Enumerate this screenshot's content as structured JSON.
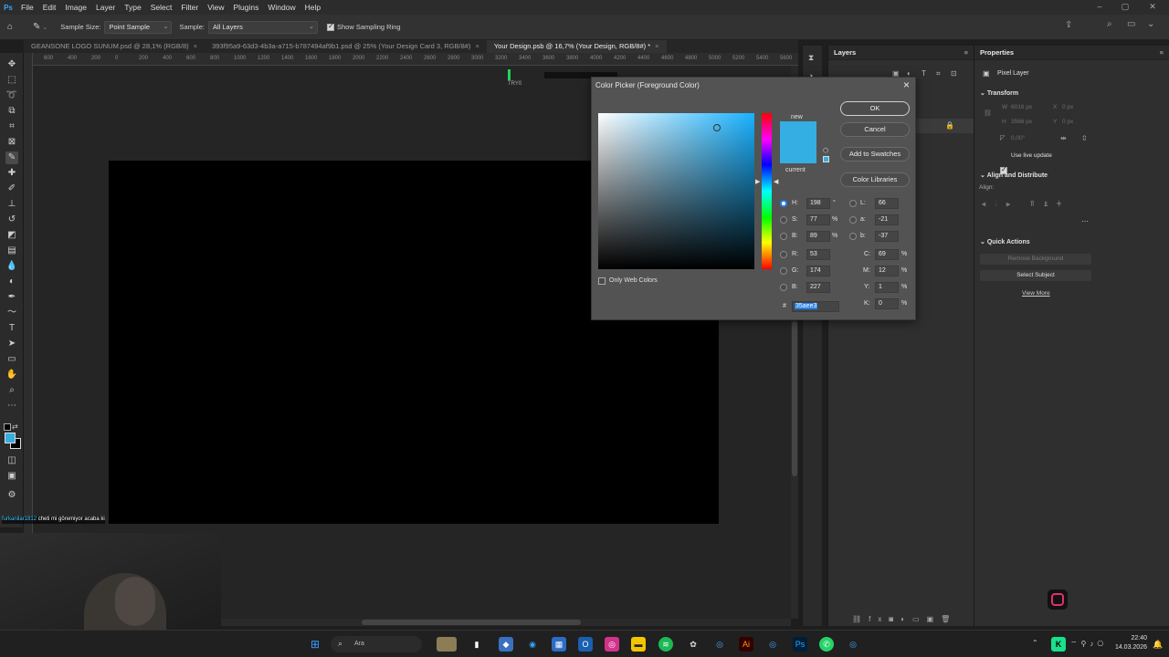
{
  "menubar": {
    "logo": "Ps",
    "items": [
      "File",
      "Edit",
      "Image",
      "Layer",
      "Type",
      "Select",
      "Filter",
      "View",
      "Plugins",
      "Window",
      "Help"
    ]
  },
  "options": {
    "sample_size_label": "Sample Size:",
    "sample_size_value": "Point Sample",
    "sample_label": "Sample:",
    "sample_value": "All Layers",
    "show_ring_label": "Show Sampling Ring",
    "show_ring_checked": true
  },
  "tabs": [
    {
      "label": "GEANSONE LOGO SUNUM.psd @ 28,1% (RGB/8)",
      "active": false
    },
    {
      "label": "393f95a9-63d3-4b3a-a715-b787494af9b1.psd @ 25% (Your Design Card 3, RGB/8#)",
      "active": false
    },
    {
      "label": "Your Design.psb @ 16,7% (Your Design, RGB/8#) *",
      "active": true
    }
  ],
  "ruler_ticks": [
    "600",
    "400",
    "200",
    "0",
    "200",
    "400",
    "600",
    "800",
    "1000",
    "1200",
    "1400",
    "1600",
    "1800",
    "2000",
    "2200",
    "2400",
    "2600",
    "2800",
    "3000",
    "3200",
    "3400",
    "3600",
    "3800",
    "4000",
    "4200",
    "4400",
    "4600",
    "4800",
    "5000",
    "5200",
    "5400",
    "5600"
  ],
  "canvas": {
    "guide_label": "TRY0"
  },
  "color_picker": {
    "title": "Color Picker (Foreground Color)",
    "new_label": "new",
    "current_label": "current",
    "ok": "OK",
    "cancel": "Cancel",
    "add_to_swatches": "Add to Swatches",
    "color_libraries": "Color Libraries",
    "only_web_colors": "Only Web Colors",
    "new_color": "#35aee3",
    "fields": {
      "H": "198",
      "S": "77",
      "B": "89",
      "R": "53",
      "G": "174",
      "B2": "227",
      "L": "66",
      "a": "-21",
      "b": "-37",
      "C": "69",
      "M": "12",
      "Y": "1",
      "K": "0"
    },
    "units": {
      "deg": "°",
      "pct": "%"
    },
    "hash": "#",
    "hex": "35aee3"
  },
  "layers_panel": {
    "title": "Layers"
  },
  "properties_panel": {
    "title": "Properties",
    "pixel_layer": "Pixel Layer",
    "transform": "Transform",
    "w_label": "W",
    "h_label": "H",
    "x_label": "X",
    "y_label": "Y",
    "w_value": "6016 px",
    "h_value": "3566 px",
    "x_value": "0 px",
    "y_value": "0 px",
    "angle_value": "0,00°",
    "use_live_update": "Use live update",
    "align_distribute": "Align and Distribute",
    "align_label": "Align:",
    "quick_actions": "Quick Actions",
    "remove_background": "Remove Background",
    "select_subject": "Select Subject",
    "view_more": "View More"
  },
  "webcam": {
    "chat_user": "furkanilar1812",
    "chat_text": "cheti mi göremiyor acaba ki"
  },
  "taskbar": {
    "search_placeholder": "Ara",
    "time": "22:40",
    "date": "14.03.2026"
  }
}
